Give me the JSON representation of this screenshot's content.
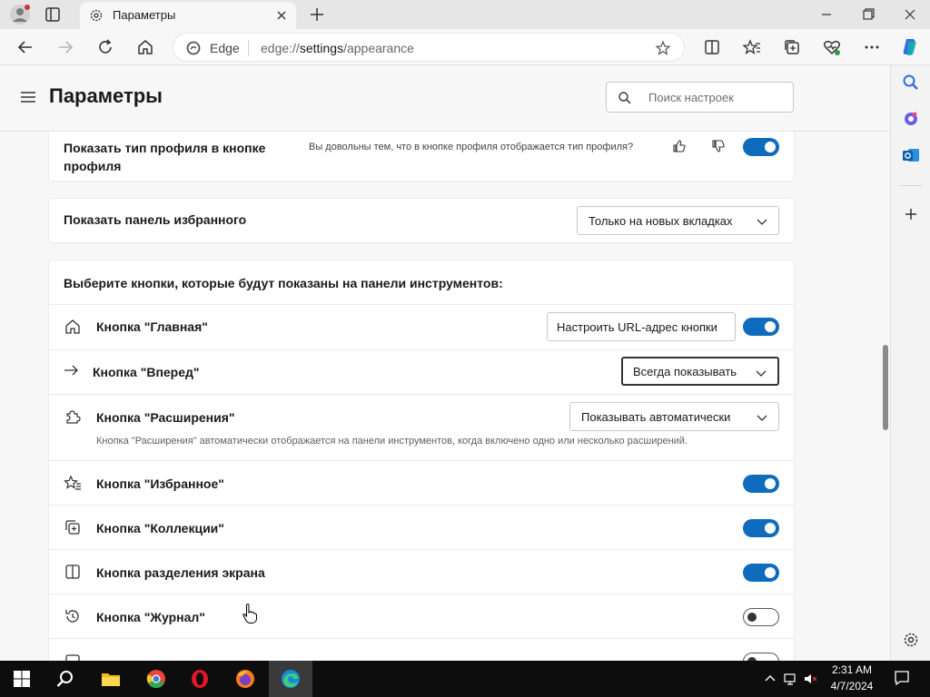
{
  "browser": {
    "tab_title": "Параметры",
    "address_brand": "Edge",
    "url_prefix": "edge://",
    "url_main": "settings",
    "url_path": "/appearance"
  },
  "settings": {
    "title": "Параметры",
    "search_placeholder": "Поиск настроек",
    "profile_type": {
      "label": "Показать тип профиля в кнопке профиля",
      "label_line1": "Показать тип профиля в кнопке",
      "label_line2": "профиля",
      "feedback_question": "Вы довольны тем, что в кнопке профиля отображается тип профиля?",
      "enabled": true
    },
    "favorites_bar": {
      "label": "Показать панель избранного",
      "value": "Только на новых вкладках"
    },
    "toolbar_section": {
      "heading": "Выберите кнопки, которые будут показаны на панели инструментов:",
      "home": {
        "label": "Кнопка \"Главная\"",
        "button": "Настроить URL-адрес кнопки",
        "enabled": true
      },
      "forward": {
        "label": "Кнопка \"Вперед\"",
        "value": "Всегда показывать"
      },
      "extensions": {
        "label": "Кнопка \"Расширения\"",
        "value": "Показывать автоматически",
        "description": "Кнопка \"Расширения\" автоматически отображается на панели инструментов, когда включено одно или несколько расширений."
      },
      "favorites": {
        "label": "Кнопка \"Избранное\"",
        "enabled": true
      },
      "collections": {
        "label": "Кнопка \"Коллекции\"",
        "enabled": true
      },
      "split_screen": {
        "label": "Кнопка разделения экрана",
        "enabled": true
      },
      "history": {
        "label": "Кнопка \"Журнал\"",
        "enabled": false
      }
    }
  },
  "taskbar": {
    "time": "2:31 AM",
    "date": "4/7/2024"
  },
  "colors": {
    "accent": "#0f6cbd",
    "taskbar": "#0d0d0d"
  }
}
